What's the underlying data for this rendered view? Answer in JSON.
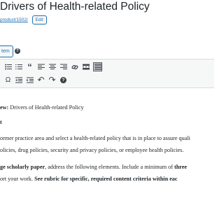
{
  "post": {
    "title": "Drivers of Health-related Policy",
    "permalink": "product/1502/",
    "edit_label": "Edit"
  },
  "media": {
    "add_item_label": "tem",
    "help_label": "?"
  },
  "toolbar": {
    "row1": [
      "bullet-list",
      "numbered-list",
      "blockquote",
      "align-left",
      "align-center",
      "align-right",
      "link",
      "more",
      "kitchen-sink"
    ],
    "row2": [
      "special-character",
      "outdent",
      "indent",
      "undo",
      "redo",
      "help"
    ],
    "glyphs": {
      "blockquote": "“",
      "special-character": "Ω",
      "undo": "↶",
      "redo": "↷",
      "help": "?"
    }
  },
  "content": {
    "heading_label": "ew:",
    "heading_value": " Drivers of Health-related Policy",
    "subheading": "t",
    "para1_line1": "ormer practice area and select a health-related policy that is in place to assure quali",
    "para1_line2": "olicies, drug policies, security and privacy policies, or employee health policies.",
    "para2_line1_bold_a": "ge scholarly paper",
    "para2_line1_text": ", address the following elements. Include a minimum of ",
    "para2_line1_bold_b": "three",
    "para2_line2_text": "ort your work. ",
    "para2_line2_bold": "See rubric for specific, required content criteria within eac"
  },
  "colors": {
    "link": "#2271b1",
    "text": "#1d2327",
    "toolbar_bg": "#f6f7f7",
    "border": "#dcdcde"
  }
}
